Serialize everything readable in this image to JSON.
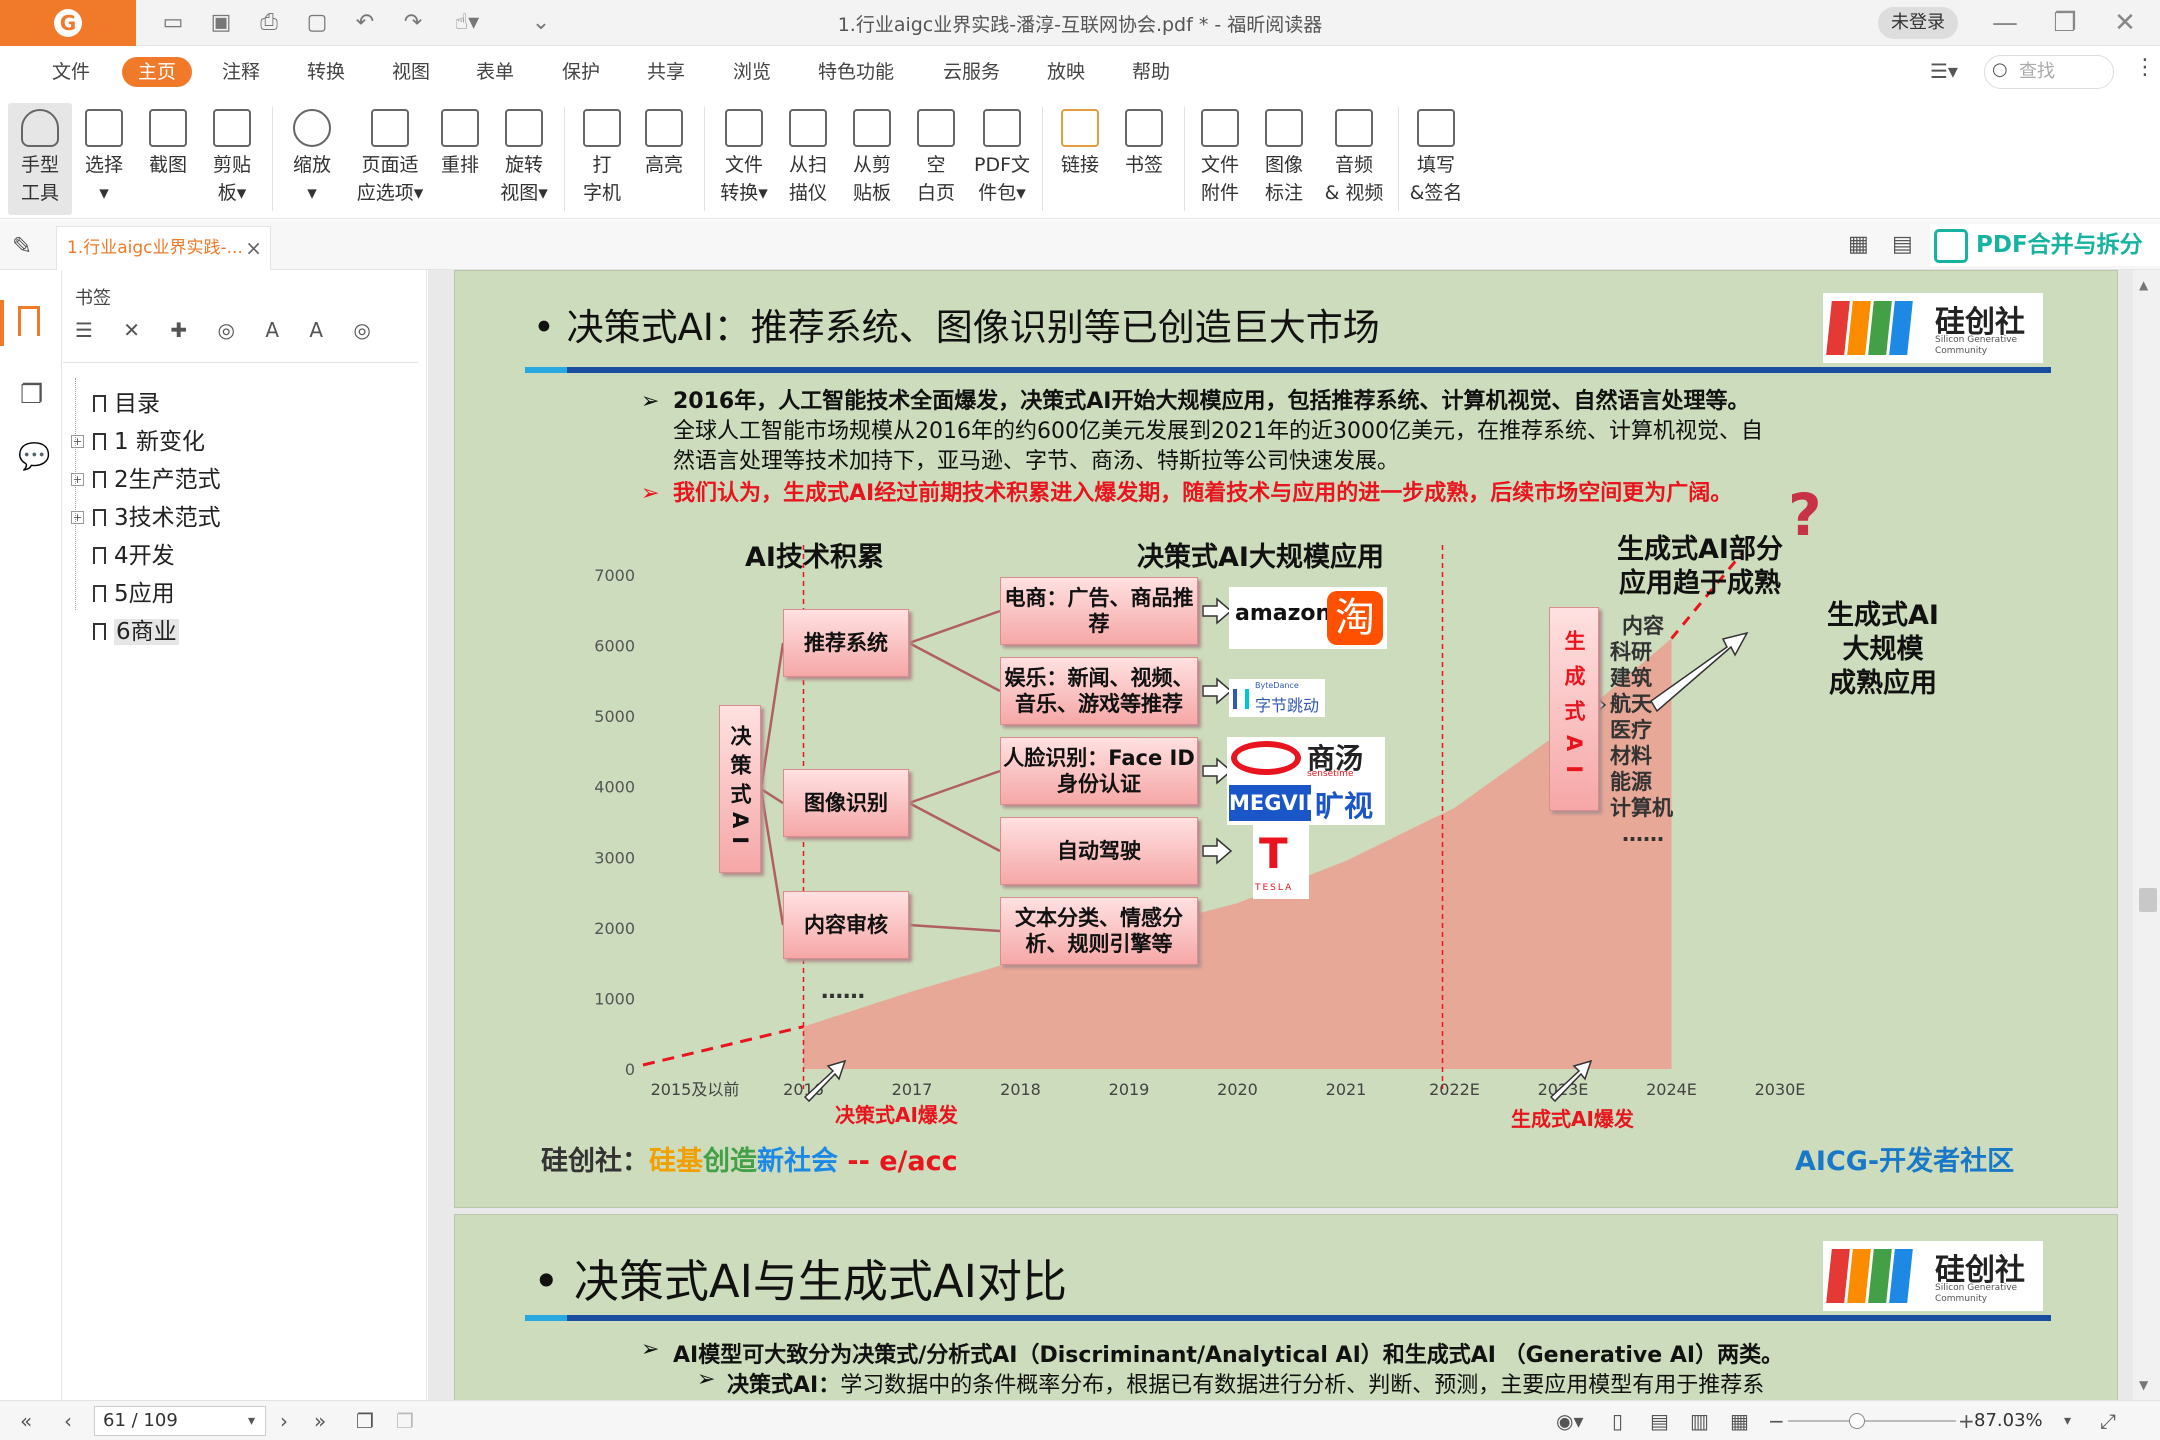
{
  "titlebar": {
    "title": "1.行业aigc业界实践-潘淳-互联网协会.pdf * - 福昕阅读器",
    "login": "未登录",
    "logo": "G"
  },
  "menu": [
    "文件",
    "主页",
    "注释",
    "转换",
    "视图",
    "表单",
    "保护",
    "共享",
    "浏览",
    "特色功能",
    "云服务",
    "放映",
    "帮助"
  ],
  "search": {
    "placeholder": "查找"
  },
  "tools": [
    {
      "l1": "手型",
      "l2": "工具"
    },
    {
      "l1": "选择",
      "l2": "▾"
    },
    {
      "l1": "截图",
      "l2": ""
    },
    {
      "l1": "剪贴",
      "l2": "板▾"
    },
    {
      "l1": "缩放",
      "l2": "▾"
    },
    {
      "l1": "页面适",
      "l2": "应选项▾"
    },
    {
      "l1": "重排",
      "l2": ""
    },
    {
      "l1": "旋转",
      "l2": "视图▾"
    },
    {
      "l1": "打",
      "l2": "字机"
    },
    {
      "l1": "高亮",
      "l2": ""
    },
    {
      "l1": "文件",
      "l2": "转换▾"
    },
    {
      "l1": "从扫",
      "l2": "描仪"
    },
    {
      "l1": "从剪",
      "l2": "贴板"
    },
    {
      "l1": "空",
      "l2": "白页"
    },
    {
      "l1": "PDF文",
      "l2": "件包▾"
    },
    {
      "l1": "链接",
      "l2": ""
    },
    {
      "l1": "书签",
      "l2": ""
    },
    {
      "l1": "文件",
      "l2": "附件"
    },
    {
      "l1": "图像",
      "l2": "标注"
    },
    {
      "l1": "音频",
      "l2": "& 视频"
    },
    {
      "l1": "填写",
      "l2": "&签名"
    }
  ],
  "tab": {
    "name": "1.行业aigc业界实践-...",
    "close": "×",
    "merge": "PDF合并与拆分"
  },
  "bookmarks": {
    "title": "书签",
    "items": [
      "目录",
      "1 新变化",
      "2生产范式",
      "3技术范式",
      "4开发",
      "5应用",
      "6商业"
    ]
  },
  "status": {
    "page": "61 / 109",
    "zoom": "87.03%"
  },
  "slide1": {
    "title": "• 决策式AI：推荐系统、图像识别等已创造巨大市场",
    "brand": "硅创社",
    "brand_en": "Silicon Generative Community",
    "b1_bold": "2016年，人工智能技术全面爆发，决策式AI开始大规模应用，包括推荐系统、计算机视觉、自然语言处理等。",
    "b1_text1": "全球人工智能市场规模从2016年的约600亿美元发展到2021年的近3000亿美元，在推荐系统、计算机视觉、自",
    "b1_text2": "然语言处理等技术加持下，亚马逊、字节、商汤、特斯拉等公司快速发展。",
    "b2": "我们认为，生成式AI经过前期技术积累进入爆发期，随着技术与应用的进一步成熟，后续市场空间更为广阔。",
    "h_left": "AI技术积累",
    "h_mid": "决策式AI大规模应用",
    "h_right1": "生成式AI部分",
    "h_right2": "应用趋于成熟",
    "gen_big1": "生成式AI",
    "gen_big2": "大规模",
    "gen_big3": "成熟应用",
    "box_ai": "决策式AI",
    "box_rec": "推荐系统",
    "box_img": "图像识别",
    "box_rev": "内容审核",
    "dots": "……",
    "app1": "电商：广告、商品推荐",
    "app2": "娱乐：新闻、视频、音乐、游戏等推荐",
    "app3": "人脸识别：Face ID身份认证",
    "app4": "自动驾驶",
    "app5": "文本分类、情感分析、规则引擎等",
    "gen_box": "生成式AI",
    "gen_list": [
      "内容",
      "科研",
      "建筑",
      "航天",
      "医疗",
      "材料",
      "能源",
      "计算机",
      "……"
    ],
    "logo_amazon": "amazon",
    "logo_taobao": "淘",
    "logo_byte": "字节跳动",
    "logo_byte_small": "ByteDance",
    "logo_sense": "商汤",
    "logo_sense_small": "sensetime",
    "logo_megvii": "MEGVII",
    "logo_megvii2": "旷视",
    "logo_tesla": "TESLA",
    "ann1": "决策式AI爆发",
    "ann2": "生成式AI爆发",
    "qmark": "?",
    "footer_label": "硅创社：",
    "footer_1": "硅基",
    "footer_2": "创造",
    "footer_3": "新社会",
    "footer_4": "-- e/acc",
    "footer_right": "AICG-开发者社区"
  },
  "chart_data": {
    "type": "area",
    "categories": [
      "2015及以前",
      "2016",
      "2017",
      "2018",
      "2019",
      "2020",
      "2021",
      "2022E",
      "2023E",
      "2024E",
      "2030E"
    ],
    "values": [
      null,
      600,
      1100,
      1550,
      1950,
      2350,
      2950,
      3700,
      4800,
      6100,
      null
    ],
    "ylim": [
      0,
      7000
    ],
    "yticks": [
      0,
      1000,
      2000,
      3000,
      4000,
      5000,
      6000,
      7000
    ]
  },
  "slide2": {
    "title": "• 决策式AI与生成式AI对比",
    "brand": "硅创社",
    "brand_en": "Silicon Generative Community",
    "b1": "AI模型可大致分为决策式/分析式AI（Discriminant/Analytical AI）和生成式AI （Generative AI）两类。",
    "b2_bold": "决策式AI：",
    "b2": "学习数据中的条件概率分布，根据已有数据进行分析、判断、预测，主要应用模型有用于推荐系"
  },
  "colors": {
    "accent": "#f07a2a",
    "slide_bg": "#ccdcbc",
    "chart_fill": "#e8a898",
    "teal": "#16b4a0",
    "red": "#e8141e"
  }
}
